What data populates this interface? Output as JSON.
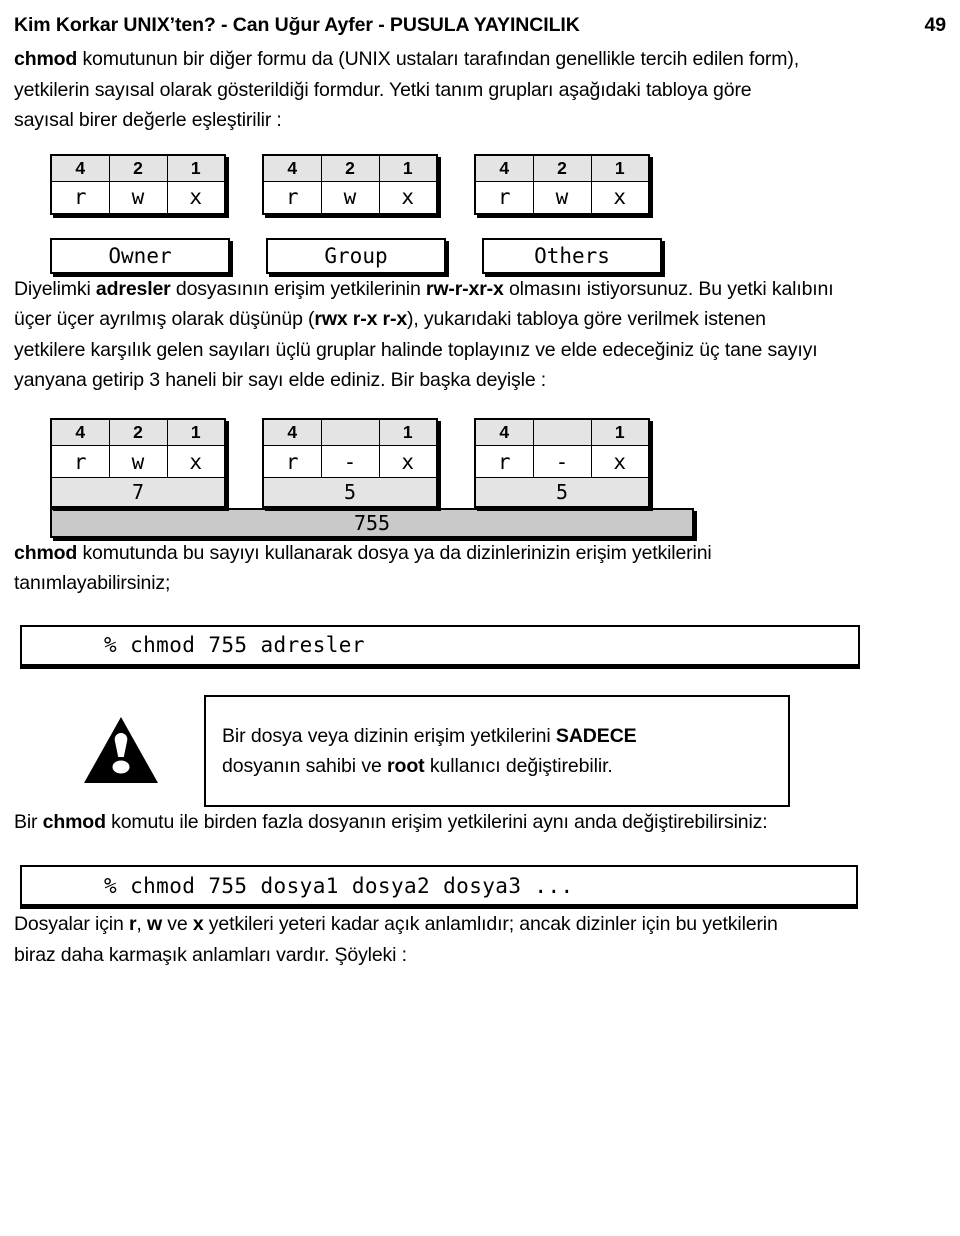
{
  "header": {
    "title": "Kim Korkar UNIX’ten?  -  Can Uğur Ayfer  -  PUSULA YAYINCILIK",
    "page_number": "49"
  },
  "paragraphs": {
    "p1_a": "chmod",
    "p1_b": " komutunun bir diğer formu da (UNIX ustaları tarafından genellikle tercih edilen form), yetkilerin sayısal olarak gösterildiği formdur. Yetki tanım grupları aşağıdaki tabloya göre sayısal birer değerle eşleştirilir :",
    "p2_a": "Diyelimki ",
    "p2_b": "adresler",
    "p2_c": " dosyasının erişim yetkilerinin  ",
    "p2_d": "rw-r-xr-x",
    "p2_e": " olmasını istiyorsunuz. Bu yetki kalıbını üçer üçer ayrılmış olarak düşünüp (",
    "p2_f": "rwx r-x r-x",
    "p2_g": "), yukarıdaki tabloya göre verilmek istenen yetkilere karşılık  gelen sayıları üçlü gruplar halinde toplayınız ve elde edeceğiniz üç tane sayıyı yanyana getirip 3 haneli bir sayı elde ediniz. Bir başka deyişle :",
    "p3_a": "chmod",
    "p3_b": " komutunda bu sayıyı kullanarak dosya ya da dizinlerinizin erişim yetkilerini tanımlayabilirsiniz;",
    "p4_a": "Bir ",
    "p4_b": "chmod",
    "p4_c": " komutu ile birden fazla dosyanın erişim yetkilerini aynı anda değiştirebilirsiniz:",
    "p5_a": "Dosyalar için ",
    "p5_b": "r",
    "p5_c": ", ",
    "p5_d": "w",
    "p5_e": " ve ",
    "p5_f": "x",
    "p5_g": " yetkileri yeteri kadar açık anlamlıdır; ancak dizinler için bu yetkilerin biraz daha karmaşık anlamları vardır. Şöyleki :"
  },
  "table1": {
    "groups": [
      {
        "numbers": [
          "4",
          "2",
          "1"
        ],
        "letters": [
          "r",
          "w",
          "x"
        ],
        "label": "Owner"
      },
      {
        "numbers": [
          "4",
          "2",
          "1"
        ],
        "letters": [
          "r",
          "w",
          "x"
        ],
        "label": "Group"
      },
      {
        "numbers": [
          "4",
          "2",
          "1"
        ],
        "letters": [
          "r",
          "w",
          "x"
        ],
        "label": "Others"
      }
    ]
  },
  "table2": {
    "groups": [
      {
        "numbers": [
          "4",
          "2",
          "1"
        ],
        "letters": [
          "r",
          "w",
          "x"
        ],
        "sum": "7"
      },
      {
        "numbers": [
          "4",
          "",
          "1"
        ],
        "letters": [
          "r",
          "-",
          "x"
        ],
        "sum": "5"
      },
      {
        "numbers": [
          "4",
          "",
          "1"
        ],
        "letters": [
          "r",
          "-",
          "x"
        ],
        "sum": "5"
      }
    ],
    "total": "755"
  },
  "commands": {
    "cmd1": "% chmod  755  adresler",
    "cmd2": "% chmod 755 dosya1 dosya2 dosya3 ..."
  },
  "warning": {
    "icon": "warning-triangle-icon",
    "line1_a": "Bir dosya veya dizinin  erişim yetkilerini ",
    "line1_b": "SADECE",
    "line2_a": "dosyanın sahibi ve ",
    "line2_b": "root",
    "line2_c": " kullanıcı değiştirebilir."
  },
  "colors": {
    "num_cell_bg": "#e4e4e4",
    "sum_cell_bg": "#e4e4e4",
    "total_bar_bg": "#c9c9c9",
    "text": "#000000",
    "page_bg": "#ffffff"
  }
}
